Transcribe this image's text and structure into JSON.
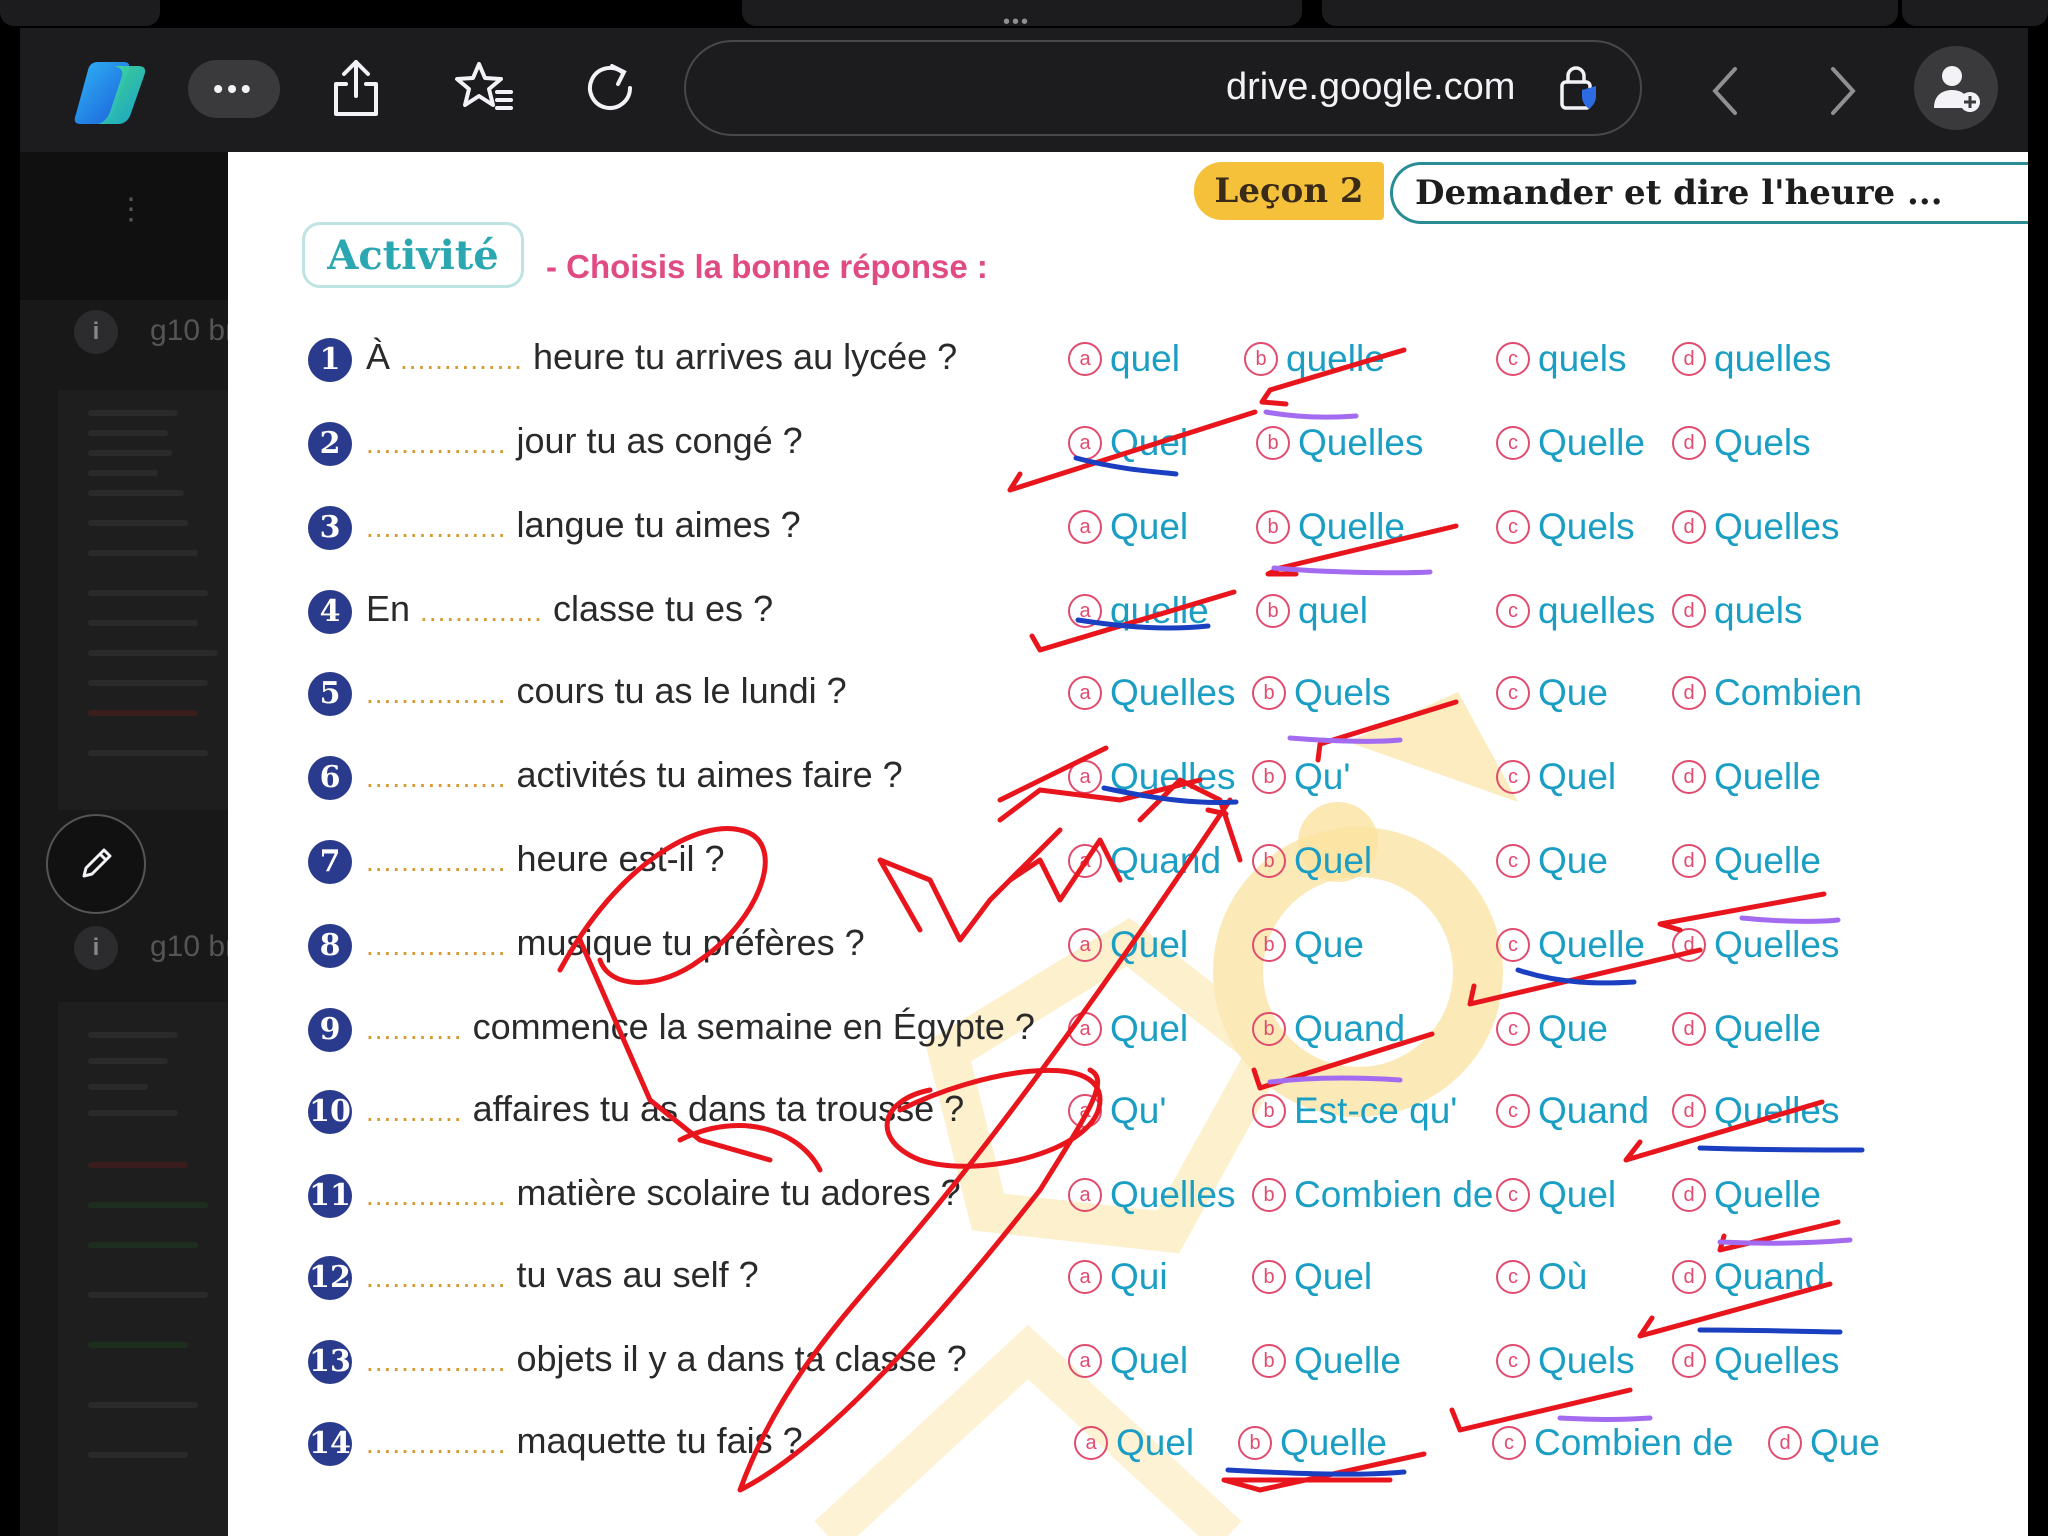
{
  "browser": {
    "url": "drive.google.com",
    "tab_dots": "•••",
    "more_label": "•••"
  },
  "sidebar": {
    "file_1": "g10 br",
    "file_2": "g10 br"
  },
  "document": {
    "lesson_label": "Leçon 2",
    "lesson_title": "Demander et dire l'heure ...",
    "activity_label": "Activité",
    "instruction": "- Choisis la bonne réponse :",
    "questions": [
      {
        "num": "1",
        "before": "À ",
        "dots": "..............",
        "after": " heure tu arrives au lycée ?",
        "options": [
          "quel",
          "quelle",
          "quels",
          "quelles"
        ]
      },
      {
        "num": "2",
        "before": "",
        "dots": "................",
        "after": " jour tu as congé ?",
        "options": [
          "Quel",
          "Quelles",
          "Quelle",
          "Quels"
        ]
      },
      {
        "num": "3",
        "before": "",
        "dots": "................",
        "after": " langue tu aimes ?",
        "options": [
          "Quel",
          "Quelle",
          "Quels",
          "Quelles"
        ]
      },
      {
        "num": "4",
        "before": "En ",
        "dots": "..............",
        "after": " classe tu es ?",
        "options": [
          "quelle",
          "quel",
          "quelles",
          "quels"
        ]
      },
      {
        "num": "5",
        "before": "",
        "dots": "................",
        "after": " cours tu as le lundi ?",
        "options": [
          "Quelles",
          "Quels",
          "Que",
          "Combien"
        ]
      },
      {
        "num": "6",
        "before": "",
        "dots": "................",
        "after": " activités tu aimes faire ?",
        "options": [
          "Quelles",
          "Qu'",
          "Quel",
          "Quelle"
        ]
      },
      {
        "num": "7",
        "before": "",
        "dots": "................",
        "after": " heure est-il ?",
        "options": [
          "Quand",
          "Quel",
          "Que",
          "Quelle"
        ]
      },
      {
        "num": "8",
        "before": "",
        "dots": "................",
        "after": " musique tu préfères ?",
        "options": [
          "Quel",
          "Que",
          "Quelle",
          "Quelles"
        ]
      },
      {
        "num": "9",
        "before": "",
        "dots": "...........",
        "after": " commence la semaine en Égypte ?",
        "options": [
          "Quel",
          "Quand",
          "Que",
          "Quelle"
        ]
      },
      {
        "num": "10",
        "before": "",
        "dots": "...........",
        "after": " affaires tu as dans ta trousse ?",
        "options": [
          "Qu'",
          "Est-ce qu'",
          "Quand",
          "Quelles"
        ]
      },
      {
        "num": "11",
        "before": "",
        "dots": "................",
        "after": " matière scolaire tu adores ?",
        "options": [
          "Quelles",
          "Combien de",
          "Quel",
          "Quelle"
        ]
      },
      {
        "num": "12",
        "before": "",
        "dots": "................",
        "after": " tu vas au self ?",
        "options": [
          "Qui",
          "Quel",
          "Où",
          "Quand"
        ]
      },
      {
        "num": "13",
        "before": "",
        "dots": "................",
        "after": " objets il y a dans ta classe ?",
        "options": [
          "Quel",
          "Quelle",
          "Quels",
          "Quelles"
        ]
      },
      {
        "num": "14",
        "before": "",
        "dots": "................",
        "after": " maquette tu fais ?",
        "options": [
          "Quel",
          "Quelle",
          "Combien de",
          "Que"
        ]
      }
    ]
  },
  "letters": [
    "a",
    "b",
    "c",
    "d"
  ],
  "colors": {
    "ink_red": "#e8161c",
    "ink_blue": "#1a3fc0",
    "ink_purple": "#a36cf0",
    "option_text": "#1a9ec4",
    "question_badge": "#2a3a8c",
    "lesson_badge": "#f5c13b"
  },
  "icons": {
    "copilot": "copilot-icon",
    "share": "share-icon",
    "favorite": "favorite-star-icon",
    "reload": "reload-icon",
    "lock": "lock-icon",
    "back": "chevron-left-icon",
    "forward": "chevron-right-icon",
    "profile": "add-profile-icon",
    "pencil": "pencil-icon"
  }
}
